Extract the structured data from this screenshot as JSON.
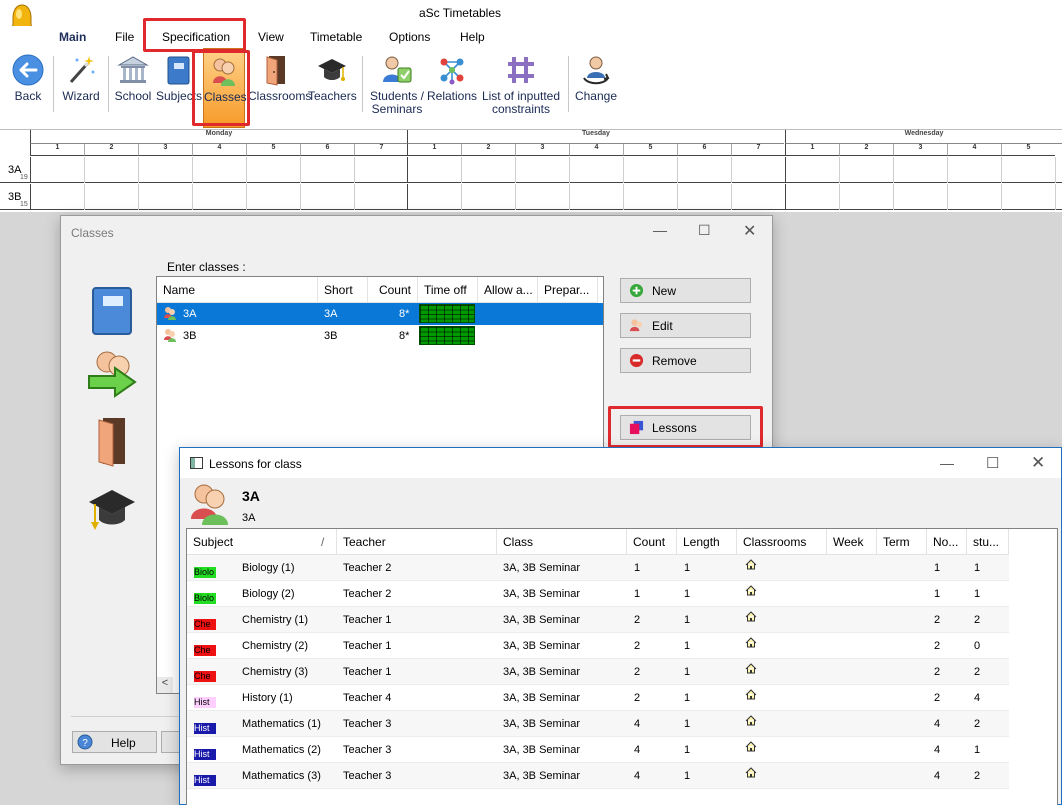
{
  "window": {
    "title": "aSc Timetables"
  },
  "menu": {
    "items": [
      "Main",
      "File",
      "Specification",
      "View",
      "Timetable",
      "Options",
      "Help"
    ]
  },
  "toolbar": {
    "back": "Back",
    "wizard": "Wizard",
    "school": "School",
    "subjects": "Subjects",
    "classes": "Classes",
    "classrooms": "Classrooms",
    "teachers": "Teachers",
    "students": "Students /\nSeminars",
    "relations": "Relations",
    "constraints": "List of inputted\nconstraints",
    "change": "Change"
  },
  "timetable": {
    "days": [
      "Monday",
      "Tuesday",
      "Wednesday"
    ],
    "periods": [
      "1",
      "2",
      "3",
      "4",
      "5",
      "6",
      "7"
    ],
    "rows": [
      {
        "name": "3A",
        "count": "19"
      },
      {
        "name": "3B",
        "count": "15"
      }
    ]
  },
  "classes_dialog": {
    "title": "Classes",
    "enter_label": "Enter classes :",
    "columns": [
      "Name",
      "Short",
      "Count",
      "Time off",
      "Allow a...",
      "Prepar..."
    ],
    "rows": [
      {
        "name": "3A",
        "short": "3A",
        "count": "8*"
      },
      {
        "name": "3B",
        "short": "3B",
        "count": "8*"
      }
    ],
    "buttons": {
      "new": "New",
      "edit": "Edit",
      "remove": "Remove",
      "lessons": "Lessons",
      "help": "Help"
    },
    "scroll_left": "<"
  },
  "lessons_dialog": {
    "title": "Lessons for class",
    "class_name": "3A",
    "class_short": "3A",
    "columns": [
      "Subject",
      "/",
      "Teacher",
      "Class",
      "Count",
      "Length",
      "Classrooms",
      "Week",
      "Term",
      "No...",
      "stu..."
    ],
    "rows": [
      {
        "chip": "Biolo",
        "chip_color": "#22dd22",
        "subject": "Biology (1)",
        "teacher": "Teacher 2",
        "class": "3A, 3B Seminar",
        "count": "1",
        "length": "1",
        "no": "1",
        "stu": "1"
      },
      {
        "chip": "Biolo",
        "chip_color": "#22dd22",
        "subject": "Biology (2)",
        "teacher": "Teacher 2",
        "class": "3A, 3B Seminar",
        "count": "1",
        "length": "1",
        "no": "1",
        "stu": "1"
      },
      {
        "chip": "Che",
        "chip_color": "#ee1111",
        "subject": "Chemistry (1)",
        "teacher": "Teacher 1",
        "class": "3A, 3B Seminar",
        "count": "2",
        "length": "1",
        "no": "2",
        "stu": "2"
      },
      {
        "chip": "Che",
        "chip_color": "#ee1111",
        "subject": "Chemistry (2)",
        "teacher": "Teacher 1",
        "class": "3A, 3B Seminar",
        "count": "2",
        "length": "1",
        "no": "2",
        "stu": "0"
      },
      {
        "chip": "Che",
        "chip_color": "#ee1111",
        "subject": "Chemistry (3)",
        "teacher": "Teacher 1",
        "class": "3A, 3B Seminar",
        "count": "2",
        "length": "1",
        "no": "2",
        "stu": "2"
      },
      {
        "chip": "Hist",
        "chip_color": "#ffd0ff",
        "subject": "History (1)",
        "teacher": "Teacher 4",
        "class": "3A, 3B Seminar",
        "count": "2",
        "length": "1",
        "no": "2",
        "stu": "4"
      },
      {
        "chip": "Hist",
        "chip_color": "#1a1aaa",
        "subject": "Mathematics (1)",
        "teacher": "Teacher 3",
        "class": "3A, 3B Seminar",
        "count": "4",
        "length": "1",
        "no": "4",
        "stu": "2"
      },
      {
        "chip": "Hist",
        "chip_color": "#1a1aaa",
        "subject": "Mathematics (2)",
        "teacher": "Teacher 3",
        "class": "3A, 3B Seminar",
        "count": "4",
        "length": "1",
        "no": "4",
        "stu": "1"
      },
      {
        "chip": "Hist",
        "chip_color": "#1a1aaa",
        "subject": "Mathematics (3)",
        "teacher": "Teacher 3",
        "class": "3A, 3B Seminar",
        "count": "4",
        "length": "1",
        "no": "4",
        "stu": "2"
      }
    ]
  }
}
